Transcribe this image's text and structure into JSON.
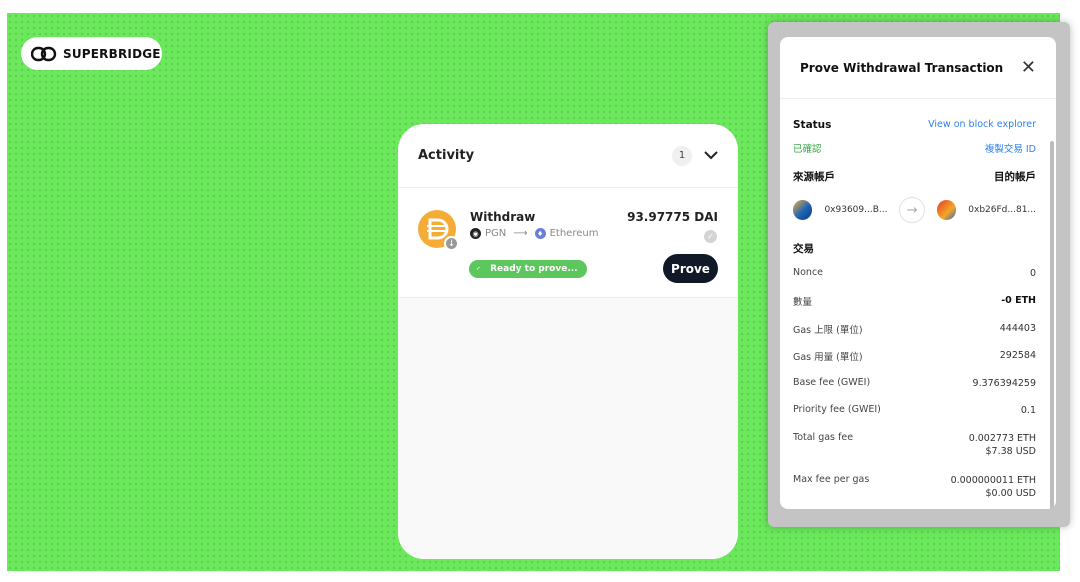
{
  "app": {
    "logo_text": "SUPERBRIDGE"
  },
  "activity": {
    "title": "Activity",
    "count": "1",
    "items": [
      {
        "type": "Withdraw",
        "amount": "93.97775 DAI",
        "from_chain": "PGN",
        "to_chain": "Ethereum",
        "status": "Ready to prove...",
        "action_label": "Prove"
      }
    ]
  },
  "modal": {
    "title": "Prove Withdrawal Transaction",
    "status_label": "Status",
    "explorer_link": "View on block explorer",
    "status_value": "已確認",
    "copy_tx_link": "複製交易 ID",
    "source_label": "來源帳戶",
    "dest_label": "目的帳戶",
    "source_address": "0x93609...B...",
    "dest_address": "0xb26Fd...81...",
    "tx_section": "交易",
    "rows": [
      {
        "label": "Nonce",
        "value": "0"
      },
      {
        "label": "數量",
        "value": "-0 ETH"
      },
      {
        "label": "Gas 上限 (單位)",
        "value": "444403"
      },
      {
        "label": "Gas 用量 (單位)",
        "value": "292584"
      },
      {
        "label": "Base fee (GWEI)",
        "value": "9.376394259"
      },
      {
        "label": "Priority fee (GWEI)",
        "value": "0.1"
      },
      {
        "label": "Total gas fee",
        "value": "0.002773 ETH",
        "value2": "$7.38 USD"
      },
      {
        "label": "Max fee per gas",
        "value": "0.000000011 ETH",
        "value2": "$0.00 USD"
      }
    ]
  },
  "colors": {
    "background": "#6be85c",
    "dai": "#f5ac37",
    "ready": "#5cc75c",
    "link": "#2f80ed",
    "confirmed": "#3aa84a"
  }
}
